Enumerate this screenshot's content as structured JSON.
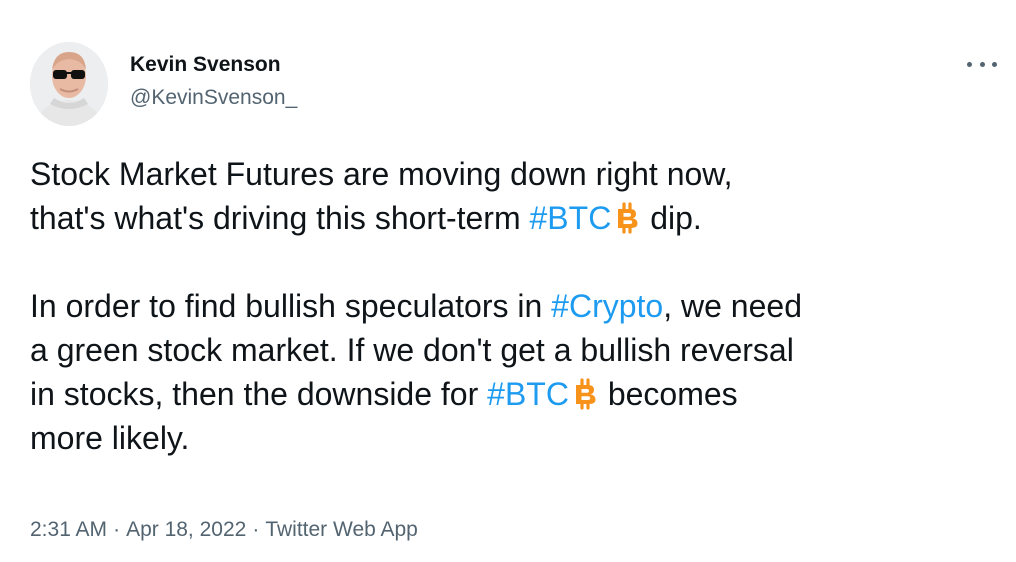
{
  "author": {
    "name": "Kevin Svenson",
    "handle": "@KevinSvenson_",
    "avatar_icon": "profile-photo-sunglasses"
  },
  "tweet": {
    "p1_l1": "Stock Market Futures are moving down right now,",
    "p1_l2_pre": "that's what's driving this short-term ",
    "tag_btc": "#BTC",
    "p1_l2_post": " dip.",
    "p2_l1_pre": "In order to find bullish speculators in ",
    "tag_crypto": "#Crypto",
    "p2_l1_post": ", we need",
    "p2_l2": "a green stock market. If we don't get a bullish reversal",
    "p2_l3_pre": "in stocks, then the downside for ",
    "p2_l3_post": " becomes",
    "p2_l4": "more likely."
  },
  "meta": {
    "time": "2:31 AM",
    "date": "Apr 18, 2022",
    "separator": "·",
    "source": "Twitter Web App"
  },
  "colors": {
    "text": "#0f1419",
    "secondary": "#536471",
    "link": "#1d9bf0",
    "bitcoin": "#f7931a"
  },
  "icons": [
    "bitcoin-emoji-icon",
    "more-options-icon"
  ]
}
